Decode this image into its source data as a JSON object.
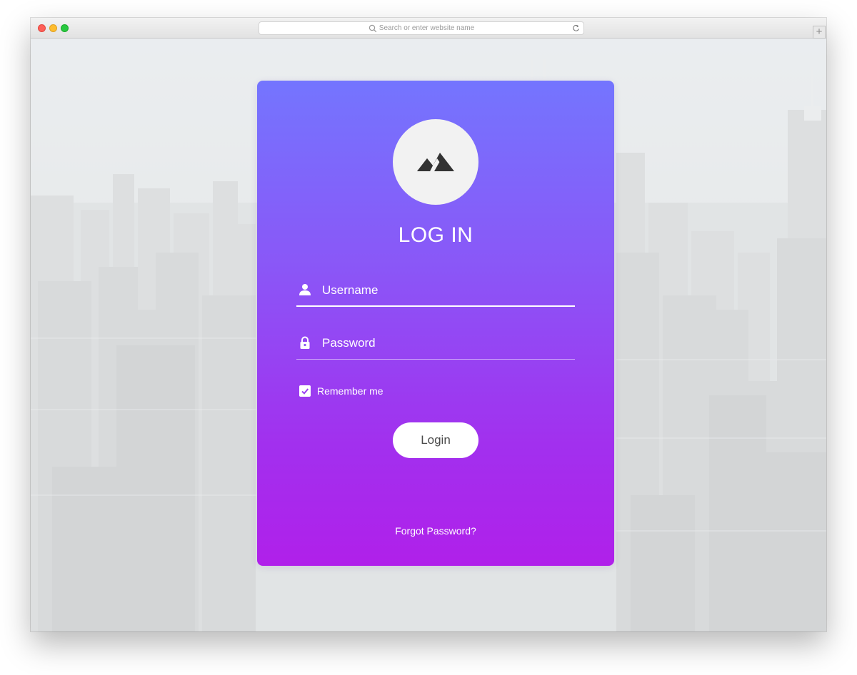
{
  "browser": {
    "url_placeholder": "Search or enter website name",
    "new_tab_symbol": "+"
  },
  "login": {
    "title": "LOG IN",
    "username_placeholder": "Username",
    "password_placeholder": "Password",
    "remember_label": "Remember me",
    "remember_checked": true,
    "login_button": "Login",
    "forgot_link": "Forgot Password?"
  },
  "colors": {
    "card_gradient_top": "#7475fe",
    "card_gradient_bottom": "#b020ea",
    "avatar_bg": "#f2f2f2",
    "icon_dark": "#333333",
    "button_text": "#4a4a4a"
  },
  "icons": {
    "avatar": "mountain-icon",
    "username": "user-icon",
    "password": "lock-icon",
    "url_search": "search-icon",
    "url_reload": "reload-icon",
    "checkbox": "check-icon"
  }
}
